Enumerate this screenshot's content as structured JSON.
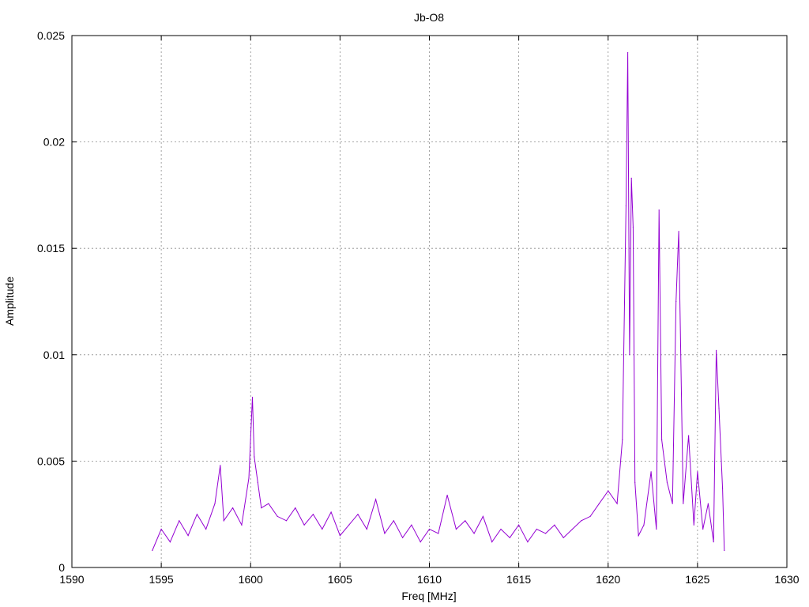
{
  "chart_data": {
    "type": "line",
    "title": "Jb-O8",
    "xlabel": "Freq [MHz]",
    "ylabel": "Amplitude",
    "xlim": [
      1590,
      1630
    ],
    "ylim": [
      0,
      0.025
    ],
    "x_ticks": [
      "1590",
      "1595",
      "1600",
      "1605",
      "1610",
      "1615",
      "1620",
      "1625",
      "1630"
    ],
    "y_ticks": [
      "0",
      "0.005",
      "0.01",
      "0.015",
      "0.02",
      "0.025"
    ],
    "x_tick_values": [
      1590,
      1595,
      1600,
      1605,
      1610,
      1615,
      1620,
      1625,
      1630
    ],
    "y_tick_values": [
      0,
      0.005,
      0.01,
      0.015,
      0.02,
      0.025
    ],
    "grid": true,
    "series": [
      {
        "color": "#9400d3",
        "x": [
          1594.5,
          1595.0,
          1595.5,
          1596.0,
          1596.5,
          1597.0,
          1597.5,
          1598.0,
          1598.3,
          1598.5,
          1599.0,
          1599.5,
          1599.9,
          1600.1,
          1600.2,
          1600.4,
          1600.6,
          1601.0,
          1601.5,
          1602.0,
          1602.5,
          1603.0,
          1603.5,
          1604.0,
          1604.5,
          1605.0,
          1605.5,
          1606.0,
          1606.5,
          1607.0,
          1607.5,
          1608.0,
          1608.5,
          1609.0,
          1609.5,
          1610.0,
          1610.5,
          1611.0,
          1611.5,
          1612.0,
          1612.5,
          1613.0,
          1613.5,
          1614.0,
          1614.5,
          1615.0,
          1615.5,
          1616.0,
          1616.5,
          1617.0,
          1617.5,
          1618.0,
          1618.5,
          1619.0,
          1619.5,
          1620.0,
          1620.5,
          1620.8,
          1621.0,
          1621.1,
          1621.2,
          1621.3,
          1621.4,
          1621.5,
          1621.7,
          1622.0,
          1622.4,
          1622.7,
          1622.85,
          1623.0,
          1623.3,
          1623.6,
          1623.8,
          1623.95,
          1624.2,
          1624.5,
          1624.8,
          1625.0,
          1625.3,
          1625.6,
          1625.9,
          1626.05,
          1626.2,
          1626.4,
          1626.5
        ],
        "y": [
          0.0008,
          0.0018,
          0.0012,
          0.0022,
          0.0015,
          0.0025,
          0.0018,
          0.003,
          0.0048,
          0.0022,
          0.0028,
          0.002,
          0.0042,
          0.008,
          0.0052,
          0.004,
          0.0028,
          0.003,
          0.0024,
          0.0022,
          0.0028,
          0.002,
          0.0025,
          0.0018,
          0.0026,
          0.0015,
          0.002,
          0.0025,
          0.0018,
          0.0032,
          0.0016,
          0.0022,
          0.0014,
          0.002,
          0.0012,
          0.0018,
          0.0016,
          0.0034,
          0.0018,
          0.0022,
          0.0016,
          0.0024,
          0.0012,
          0.0018,
          0.0014,
          0.002,
          0.0012,
          0.0018,
          0.0016,
          0.002,
          0.0014,
          0.0018,
          0.0022,
          0.0024,
          0.003,
          0.0036,
          0.003,
          0.006,
          0.017,
          0.0242,
          0.01,
          0.0183,
          0.016,
          0.004,
          0.0015,
          0.002,
          0.0045,
          0.0018,
          0.0168,
          0.006,
          0.004,
          0.003,
          0.0125,
          0.0158,
          0.003,
          0.0062,
          0.002,
          0.0045,
          0.0018,
          0.003,
          0.0012,
          0.0102,
          0.0075,
          0.0037,
          0.0008
        ]
      }
    ]
  }
}
